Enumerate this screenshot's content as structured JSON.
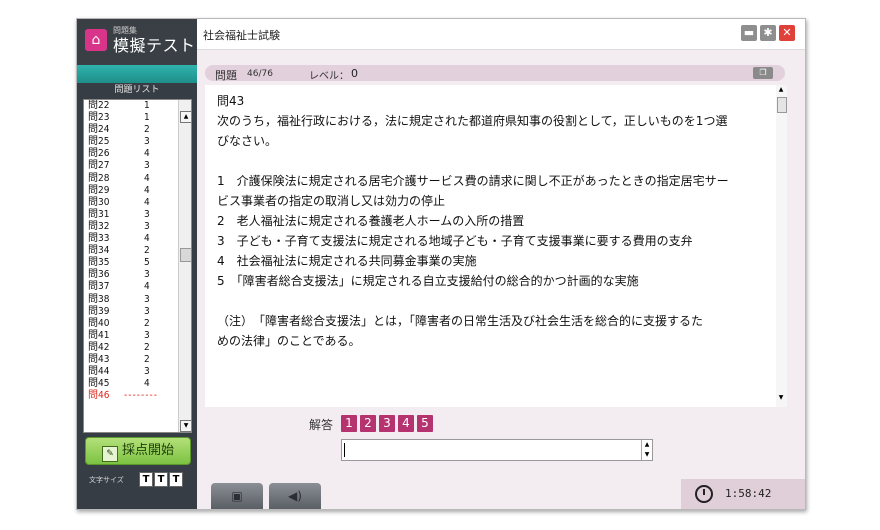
{
  "app": {
    "logo_sub": "問題集",
    "logo_main": "模擬テスト",
    "exam_title": "社会福祉士試験"
  },
  "sidebar": {
    "list_title": "問題リスト",
    "questions": [
      {
        "num": "問22",
        "ans": "1"
      },
      {
        "num": "問23",
        "ans": "1"
      },
      {
        "num": "問24",
        "ans": "2"
      },
      {
        "num": "問25",
        "ans": "3"
      },
      {
        "num": "問26",
        "ans": "4"
      },
      {
        "num": "問27",
        "ans": "3"
      },
      {
        "num": "問28",
        "ans": "4"
      },
      {
        "num": "問29",
        "ans": "4"
      },
      {
        "num": "問30",
        "ans": "4"
      },
      {
        "num": "問31",
        "ans": "3"
      },
      {
        "num": "問32",
        "ans": "3"
      },
      {
        "num": "問33",
        "ans": "4"
      },
      {
        "num": "問34",
        "ans": "2"
      },
      {
        "num": "問35",
        "ans": "5"
      },
      {
        "num": "問36",
        "ans": "3"
      },
      {
        "num": "問37",
        "ans": "4"
      },
      {
        "num": "問38",
        "ans": "3"
      },
      {
        "num": "問39",
        "ans": "3"
      },
      {
        "num": "問40",
        "ans": "2"
      },
      {
        "num": "問41",
        "ans": "3"
      },
      {
        "num": "問42",
        "ans": "2"
      },
      {
        "num": "問43",
        "ans": "2"
      },
      {
        "num": "問44",
        "ans": "3"
      },
      {
        "num": "問45",
        "ans": "4"
      },
      {
        "num": "問46",
        "ans": "--------",
        "current": true
      }
    ],
    "grade_button": "採点開始",
    "font_size_label": "文字サイズ",
    "font_buttons": [
      "T",
      "T",
      "T"
    ]
  },
  "question": {
    "label": "問題",
    "count": "46/76",
    "level_label": "レベル：",
    "level_value": "0",
    "number": "問43",
    "stem_1": "次のうち，福祉行政における，法に規定された都道府県知事の役割として，正しいものを1つ選",
    "stem_2": "びなさい。",
    "option_1a": "1　介護保険法に規定される居宅介護サービス費の請求に関し不正があったときの指定居宅サー",
    "option_1b": "ビス事業者の指定の取消し又は効力の停止",
    "option_2": "2　老人福祉法に規定される養護老人ホームの入所の措置",
    "option_3": "3　子ども・子育て支援法に規定される地域子ども・子育て支援事業に要する費用の支弁",
    "option_4": "4　社会福祉法に規定される共同募金事業の実施",
    "option_5": "5　「障害者総合支援法」に規定される自立支援給付の総合的かつ計画的な実施",
    "note_1": "（注）　「障害者総合支援法」とは，「障害者の日常生活及び社会生活を総合的に支援するた",
    "note_2": "めの法律」のことである。"
  },
  "answer": {
    "label": "解答",
    "choices": [
      "1",
      "2",
      "3",
      "4",
      "5"
    ],
    "input_value": ""
  },
  "timer": {
    "value": "1:58:42"
  },
  "colors": {
    "accent": "#b5346f",
    "sidebar_bg": "#373d44",
    "teal": "#2fb3ad",
    "current_question": "#e0261b"
  }
}
